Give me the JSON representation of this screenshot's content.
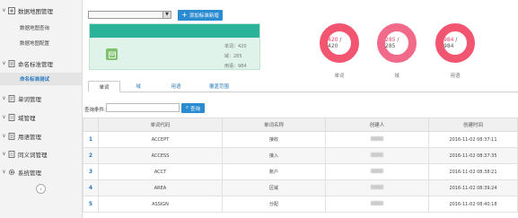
{
  "sidebar": {
    "groups": [
      {
        "label": "数据地图管理",
        "chevron": "∨",
        "icon": "map-icon"
      },
      {
        "label": "命名标准管理",
        "chevron": "∨",
        "icon": "doc-icon"
      },
      {
        "label": "单词管理",
        "chevron": "∨",
        "icon": "word-icon"
      },
      {
        "label": "域管理",
        "chevron": "∨",
        "icon": "domain-icon"
      },
      {
        "label": "用语管理",
        "chevron": "∨",
        "icon": "term-icon"
      },
      {
        "label": "同义词管理",
        "chevron": "∨",
        "icon": "synonym-icon"
      },
      {
        "label": "系统管理",
        "chevron": "∨",
        "icon": "gear-icon"
      }
    ],
    "subitems": [
      {
        "label": "数据地图查询"
      },
      {
        "label": "数据地图配置"
      },
      {
        "label": "命名标准测试"
      }
    ],
    "collapse": "‹"
  },
  "toolbar": {
    "add_label": "添加标准新增",
    "add_icon": "+"
  },
  "card": {
    "stats": [
      "单词：420",
      "域：285",
      "用语：984"
    ]
  },
  "donuts": [
    {
      "value": "420",
      "total": "420",
      "sep": " / ",
      "label": "单词",
      "color": "#f2556f"
    },
    {
      "value": "285",
      "total": "285",
      "sep": " / ",
      "label": "域",
      "color": "#f26a8a"
    },
    {
      "value": "984",
      "total": "984",
      "sep": " / ",
      "label": "用语",
      "color": "#f2556f"
    }
  ],
  "tabs": [
    "单词",
    "域",
    "用语",
    "覆盖范围"
  ],
  "query": {
    "label": "查询条件:",
    "button": "查询",
    "button_icon": "⌕"
  },
  "table": {
    "headers": [
      "",
      "单词代码",
      "单词名称",
      "创建人",
      "创建时间"
    ],
    "rows": [
      {
        "num": "1",
        "code": "ACCEPT",
        "name": "接收",
        "time": "2016-11-02 08:37:11"
      },
      {
        "num": "2",
        "code": "ACCESS",
        "name": "接入",
        "time": "2016-11-02 08:37:35"
      },
      {
        "num": "3",
        "code": "ACCT",
        "name": "账户",
        "time": "2016-11-02 08:38:21"
      },
      {
        "num": "4",
        "code": "AREA",
        "name": "区域",
        "time": "2016-11-02 08:39:24"
      },
      {
        "num": "5",
        "code": "ASSIGN",
        "name": "分配",
        "time": "2016-11-02 08:40:18"
      }
    ]
  }
}
